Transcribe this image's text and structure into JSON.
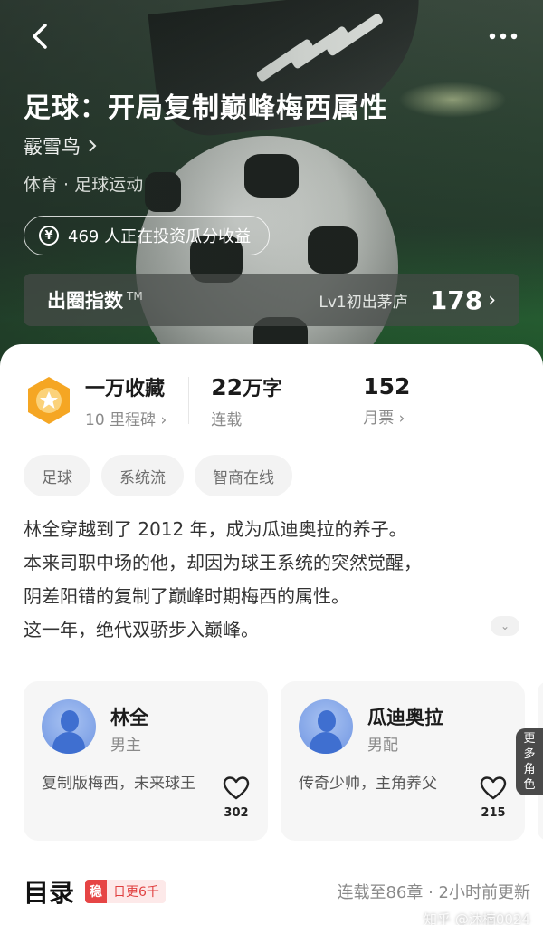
{
  "header": {
    "title": "足球：开局复制巅峰梅西属性",
    "author": "霰雪鸟",
    "category": "体育 · 足球运动",
    "invest_text": "469 人正在投资瓜分收益",
    "index": {
      "label": "出圈指数",
      "tm": "TM",
      "level": "Lv1初出茅庐",
      "score": "178"
    }
  },
  "stats": {
    "collect_main": "一万收藏",
    "collect_sub": "10 里程碑",
    "words_num": "22",
    "words_unit": "万字",
    "words_sub": "连载",
    "tickets_num": "152",
    "tickets_sub": "月票"
  },
  "tags": [
    "足球",
    "系统流",
    "智商在线"
  ],
  "synopsis": [
    "林全穿越到了 2012 年，成为瓜迪奥拉的养子。",
    "本来司职中场的他，却因为球王系统的突然觉醒，",
    "阴差阳错的复制了巅峰时期梅西的属性。",
    "这一年，绝代双骄步入巅峰。"
  ],
  "characters": [
    {
      "name": "林全",
      "role": "男主",
      "desc": "复制版梅西，未来球王",
      "likes": "302"
    },
    {
      "name": "瓜迪奥拉",
      "role": "男配",
      "desc": "传奇少帅，主角养父",
      "likes": "215"
    }
  ],
  "more_roles": [
    "更",
    "多",
    "角",
    "色"
  ],
  "toc": {
    "title": "目录",
    "badge_icon": "稳",
    "badge_text": "日更6千",
    "status": "连载至86章 · 2小时前更新"
  },
  "watermark": "知乎 @沐楠0024",
  "colors": {
    "accent": "#e64545",
    "badge_orange": "#f5a623",
    "avatar_blue": "#6f95e2"
  }
}
